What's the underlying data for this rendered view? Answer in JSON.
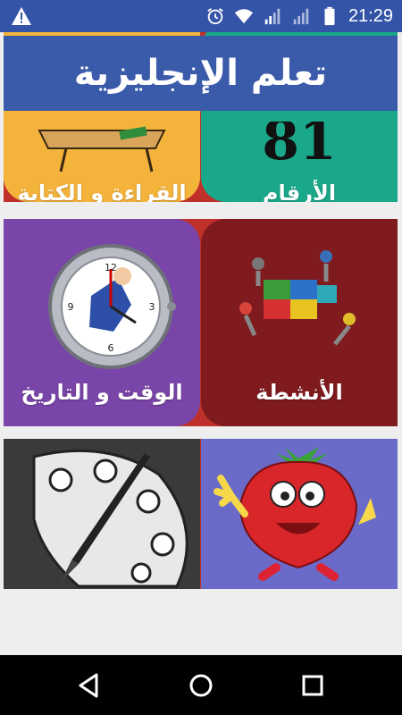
{
  "status_bar": {
    "time": "21:29",
    "icons": [
      "warning-icon",
      "alarm-icon",
      "wifi-icon",
      "signal-icon",
      "signal-icon",
      "battery-icon"
    ]
  },
  "banner": {
    "title": "تعلم الإنجليزية"
  },
  "tiles": [
    {
      "label": "القراءة و الكتابة",
      "bg": "#f4b33b",
      "icon": "reading-desk-icon"
    },
    {
      "label": "الأرقام",
      "bg": "#1aa88b",
      "icon": "numbers-icon"
    },
    {
      "label": "الوقت و التاريخ",
      "bg": "#7a45a8",
      "icon": "clock-icon"
    },
    {
      "label": "الأنشطة",
      "bg": "#7f1a1e",
      "icon": "puzzle-team-icon"
    },
    {
      "label": "",
      "bg": "#3a3a3a",
      "icon": "paint-palette-icon"
    },
    {
      "label": "",
      "bg": "#6a6ac8",
      "icon": "strawberry-icon"
    }
  ],
  "nav_bar": {
    "buttons": [
      "back-icon",
      "home-icon",
      "recents-icon"
    ]
  }
}
